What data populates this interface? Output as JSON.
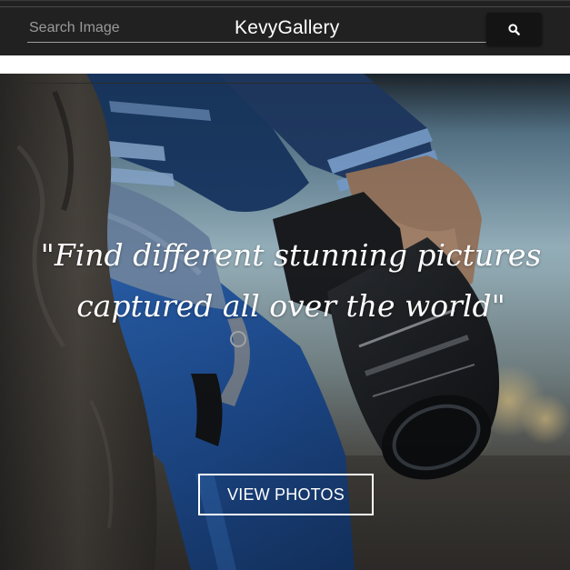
{
  "header": {
    "search": {
      "placeholder": "Search Image",
      "value": ""
    },
    "brand": "KevyGallery",
    "search_button_icon": "search-icon",
    "background": "#212121"
  },
  "hero": {
    "image_icon": "camera-photo",
    "tagline_line1": "\"Find different stunning pictures",
    "tagline_line2": "captured all over the world\"",
    "cta_label": "VIEW PHOTOS",
    "cta_border_color": "#ffffff"
  }
}
